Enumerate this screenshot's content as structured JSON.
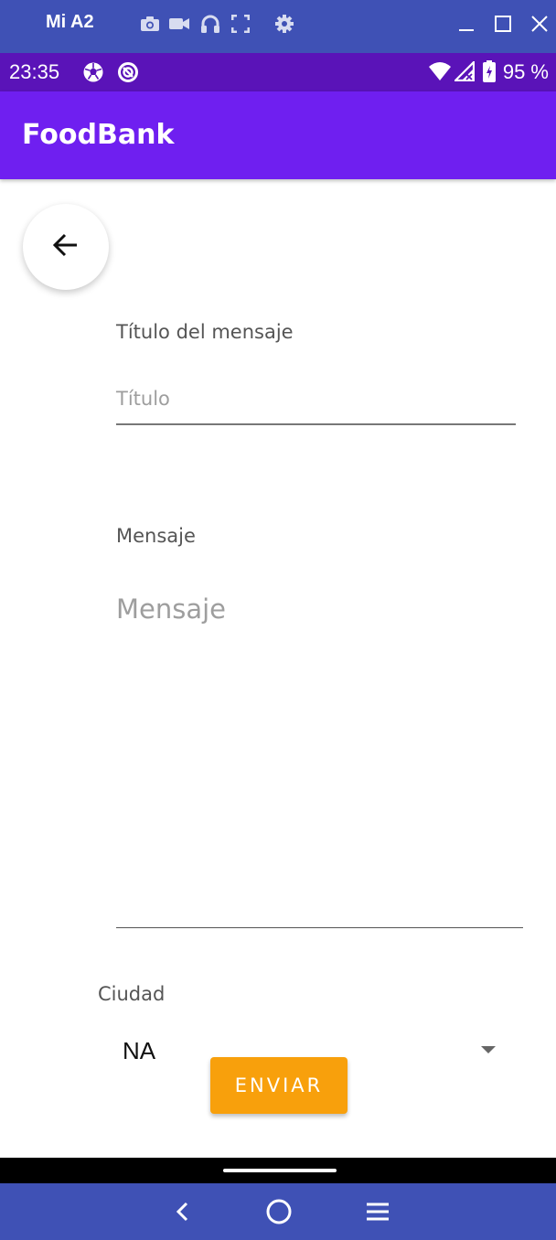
{
  "window": {
    "title": "Mi A2",
    "icons": [
      "camera-icon",
      "video-icon",
      "headphones-icon",
      "fullscreen-icon",
      "settings-icon"
    ],
    "controls": [
      "minimize-icon",
      "maximize-icon",
      "close-icon"
    ]
  },
  "status_bar": {
    "time": "23:35",
    "left_icons": [
      "soccer-ball-icon",
      "data-saver-icon"
    ],
    "right_icons": [
      "wifi-icon",
      "signal-icon",
      "battery-icon"
    ],
    "battery_text": "95 %"
  },
  "app_bar": {
    "title": "FoodBank"
  },
  "form": {
    "back_icon": "arrow-back-icon",
    "title_label": "Título del mensaje",
    "title_placeholder": "Título",
    "message_label": "Mensaje",
    "message_placeholder": "Mensaje",
    "city_label": "Ciudad",
    "city_value": "NA",
    "send_label": "ENVIAR"
  },
  "nav_bar": {
    "icons": [
      "nav-back-icon",
      "nav-home-icon",
      "nav-menu-icon"
    ]
  },
  "colors": {
    "window_bar": "#3f51b5",
    "status_bar": "#5a13b8",
    "app_bar": "#6f1ff0",
    "accent_button": "#f8a00c"
  }
}
